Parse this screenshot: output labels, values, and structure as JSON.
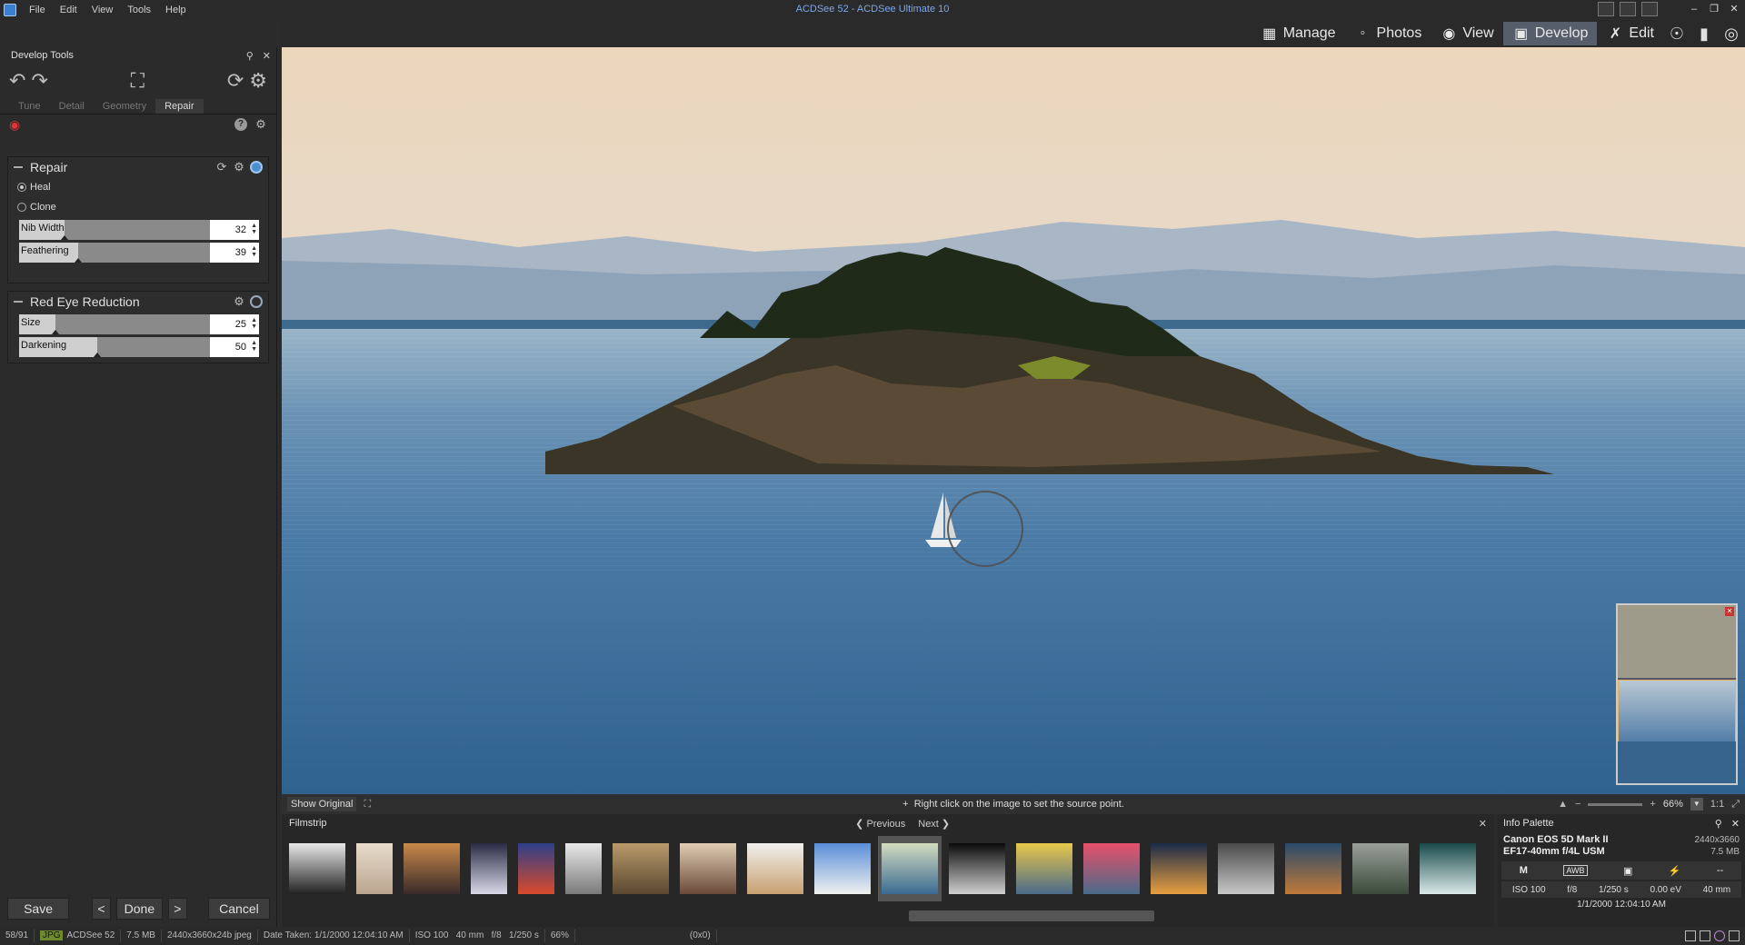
{
  "window": {
    "title": "ACDSee 52 - ACDSee Ultimate 10",
    "menu": [
      "File",
      "Edit",
      "View",
      "Tools",
      "Help"
    ]
  },
  "modes": [
    {
      "label": "Manage",
      "icon": "grid-icon"
    },
    {
      "label": "Photos",
      "icon": "photos-icon"
    },
    {
      "label": "View",
      "icon": "eye-icon"
    },
    {
      "label": "Develop",
      "icon": "develop-icon",
      "active": true
    },
    {
      "label": "Edit",
      "icon": "edit-icon"
    }
  ],
  "left_panel": {
    "title": "Develop Tools",
    "tabs": [
      "Tune",
      "Detail",
      "Geometry",
      "Repair"
    ],
    "active_tab": "Repair",
    "repair": {
      "title": "Repair",
      "options": [
        "Heal",
        "Clone"
      ],
      "selected": "Heal",
      "sliders": [
        {
          "label": "Nib Width",
          "value": "32",
          "fraction": 0.24
        },
        {
          "label": "Feathering",
          "value": "39",
          "fraction": 0.31
        }
      ]
    },
    "red_eye": {
      "title": "Red Eye Reduction",
      "sliders": [
        {
          "label": "Size",
          "value": "25",
          "fraction": 0.19
        },
        {
          "label": "Darkening",
          "value": "50",
          "fraction": 0.41
        }
      ]
    },
    "buttons": {
      "save": "Save",
      "prev": "<",
      "done": "Done",
      "next": ">",
      "cancel": "Cancel"
    }
  },
  "viewer": {
    "show_original": "Show Original",
    "hint": "Right click on the image to set the source point.",
    "zoom": "66%",
    "ratio": "1:1"
  },
  "filmstrip": {
    "title": "Filmstrip",
    "previous": "Previous",
    "next": "Next",
    "thumbs": [
      {
        "w": 62,
        "c1": "#e8e8e8",
        "c2": "#222"
      },
      {
        "w": 40,
        "c1": "#e9dccd",
        "c2": "#b9a58e"
      },
      {
        "w": 62,
        "c1": "#c8894a",
        "c2": "#3a2a2a"
      },
      {
        "w": 40,
        "c1": "#2a2a44",
        "c2": "#d8d8e8"
      },
      {
        "w": 40,
        "c1": "#2d3f8a",
        "c2": "#d94a2b"
      },
      {
        "w": 40,
        "c1": "#e8e8e8",
        "c2": "#7a7a7a"
      },
      {
        "w": 62,
        "c1": "#b99a6a",
        "c2": "#5a4830"
      },
      {
        "w": 62,
        "c1": "#e0cdb3",
        "c2": "#6a4a3a"
      },
      {
        "w": 62,
        "c1": "#f0f0ee",
        "c2": "#c8a070"
      },
      {
        "w": 62,
        "c1": "#5a8ed8",
        "c2": "#f0f0f0"
      },
      {
        "w": 62,
        "c1": "#d4dcc0",
        "c2": "#3a6a92",
        "selected": true
      },
      {
        "w": 62,
        "c1": "#0a0a0a",
        "c2": "#d0d0d0"
      },
      {
        "w": 62,
        "c1": "#e8c84a",
        "c2": "#4a6a8a"
      },
      {
        "w": 62,
        "c1": "#e8506a",
        "c2": "#4a6a8a"
      },
      {
        "w": 62,
        "c1": "#1a2a48",
        "c2": "#e8a040"
      },
      {
        "w": 62,
        "c1": "#4a4a4a",
        "c2": "#c8c8c8"
      },
      {
        "w": 62,
        "c1": "#2a4a6a",
        "c2": "#c07a3a"
      },
      {
        "w": 62,
        "c1": "#9aa09a",
        "c2": "#3a4a3a"
      },
      {
        "w": 62,
        "c1": "#1a4a4a",
        "c2": "#dae8e8"
      }
    ]
  },
  "info": {
    "title": "Info Palette",
    "camera": "Canon EOS 5D Mark II",
    "lens": "EF17-40mm f/4L USM",
    "dimensions": "2440x3660",
    "size": "7.5 MB",
    "mode": "M",
    "wb": "AWB",
    "ev_dash": "--",
    "iso": "ISO 100",
    "aperture": "f/8",
    "shutter": "1/250 s",
    "ev": "0.00 eV",
    "focal": "40 mm",
    "date": "1/1/2000 12:04:10 AM"
  },
  "status": {
    "index": "58/91",
    "badge": "JPG",
    "name": "ACDSee 52",
    "size": "7.5 MB",
    "format": "2440x3660x24b jpeg",
    "date": "Date Taken: 1/1/2000 12:04:10 AM",
    "exif": "ISO 100   40 mm   f/8   1/250 s",
    "zoom": "66%",
    "coords": "(0x0)"
  }
}
